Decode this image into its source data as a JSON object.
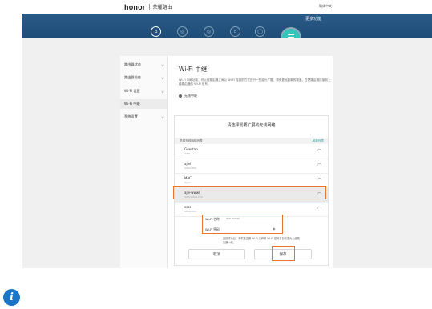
{
  "header": {
    "brand_logo": "honor",
    "brand_sub": "荣耀路由",
    "lang": "简体中文"
  },
  "nav": {
    "more_label": "更多功能",
    "icons": [
      "home-icon",
      "network-icon",
      "wifi-icon",
      "devices-icon",
      "user-icon"
    ]
  },
  "sidebar": {
    "items": [
      {
        "label": "路由器状态"
      },
      {
        "label": "路由器检查"
      },
      {
        "label": "Wi-Fi 设置"
      },
      {
        "label": "Wi-Fi 中继"
      },
      {
        "label": "系统设置"
      }
    ]
  },
  "main": {
    "title": "Wi-Fi 中继",
    "desc": "Wi-Fi 中继功能，可以在路由器之间以 Wi-Fi 连接的方式进行一些延长扩展，带来更远距离的覆盖。在把路由器连接到上级路由器的 Wi-Fi 信号。",
    "toggle_label": "无线中继",
    "panel": {
      "title": "请选择需要扩展的无线网络",
      "list_header": "选择无线网络列表",
      "refresh": "刷新列表",
      "networks": [
        {
          "name": "Guestap",
          "status": "WEP"
        },
        {
          "name": "ajwl",
          "status": "WPA2-PSK"
        },
        {
          "name": "MAC",
          "status": "Open"
        },
        {
          "name": "ajw-wwwl",
          "status": "WPA/WPA2-PSK"
        },
        {
          "name": "ssss",
          "status": "WPA2-PSK"
        }
      ],
      "name_label": "Wi-Fi 名称",
      "name_value": "ajw-wwwl",
      "pwd_label": "Wi-Fi 密码",
      "hint": "连接成功后，本机路由器 Wi-Fi 名称和 Wi-Fi 密码将自动变为上级路由器一致。",
      "cancel": "取消",
      "save": "保存"
    }
  },
  "info_icon": "i"
}
